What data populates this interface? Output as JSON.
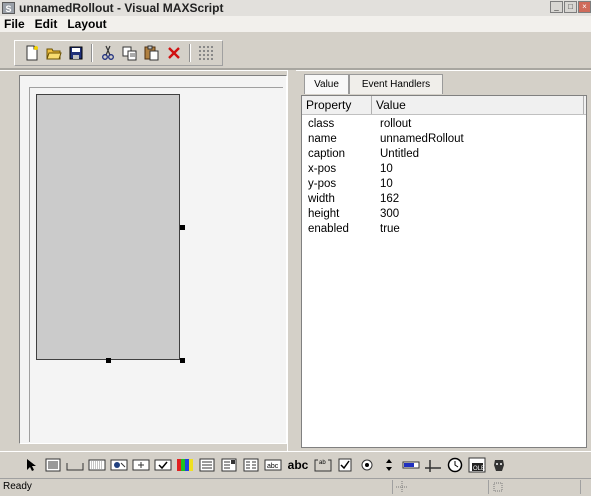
{
  "window": {
    "title": "unnamedRollout - Visual MAXScript"
  },
  "menu": [
    "File",
    "Edit",
    "Layout"
  ],
  "toolbar": {
    "icons": [
      "new-icon",
      "open-icon",
      "save-icon",
      "cut-icon",
      "copy-icon",
      "paste-icon",
      "delete-icon",
      "grid-icon"
    ]
  },
  "tabs": {
    "value": "Value",
    "event_handlers": "Event Handlers"
  },
  "properties": {
    "header": {
      "property": "Property",
      "value": "Value"
    },
    "rows": [
      {
        "property": "class",
        "value": "rollout"
      },
      {
        "property": "name",
        "value": "unnamedRollout"
      },
      {
        "property": "caption",
        "value": "Untitled"
      },
      {
        "property": "x-pos",
        "value": "10"
      },
      {
        "property": "y-pos",
        "value": "10"
      },
      {
        "property": "width",
        "value": "162"
      },
      {
        "property": "height",
        "value": "300"
      },
      {
        "property": "enabled",
        "value": "true"
      }
    ]
  },
  "controls_bar": {
    "labels": {
      "abc": "abc",
      "abc_small": "abc",
      "ab": "ab",
      "ole": "OLE"
    }
  },
  "status": {
    "text": "Ready"
  },
  "colors": {
    "panel": "#d4d0c8",
    "canvas": "#f4f4f4",
    "rollout_fill": "#cbcbcb"
  }
}
